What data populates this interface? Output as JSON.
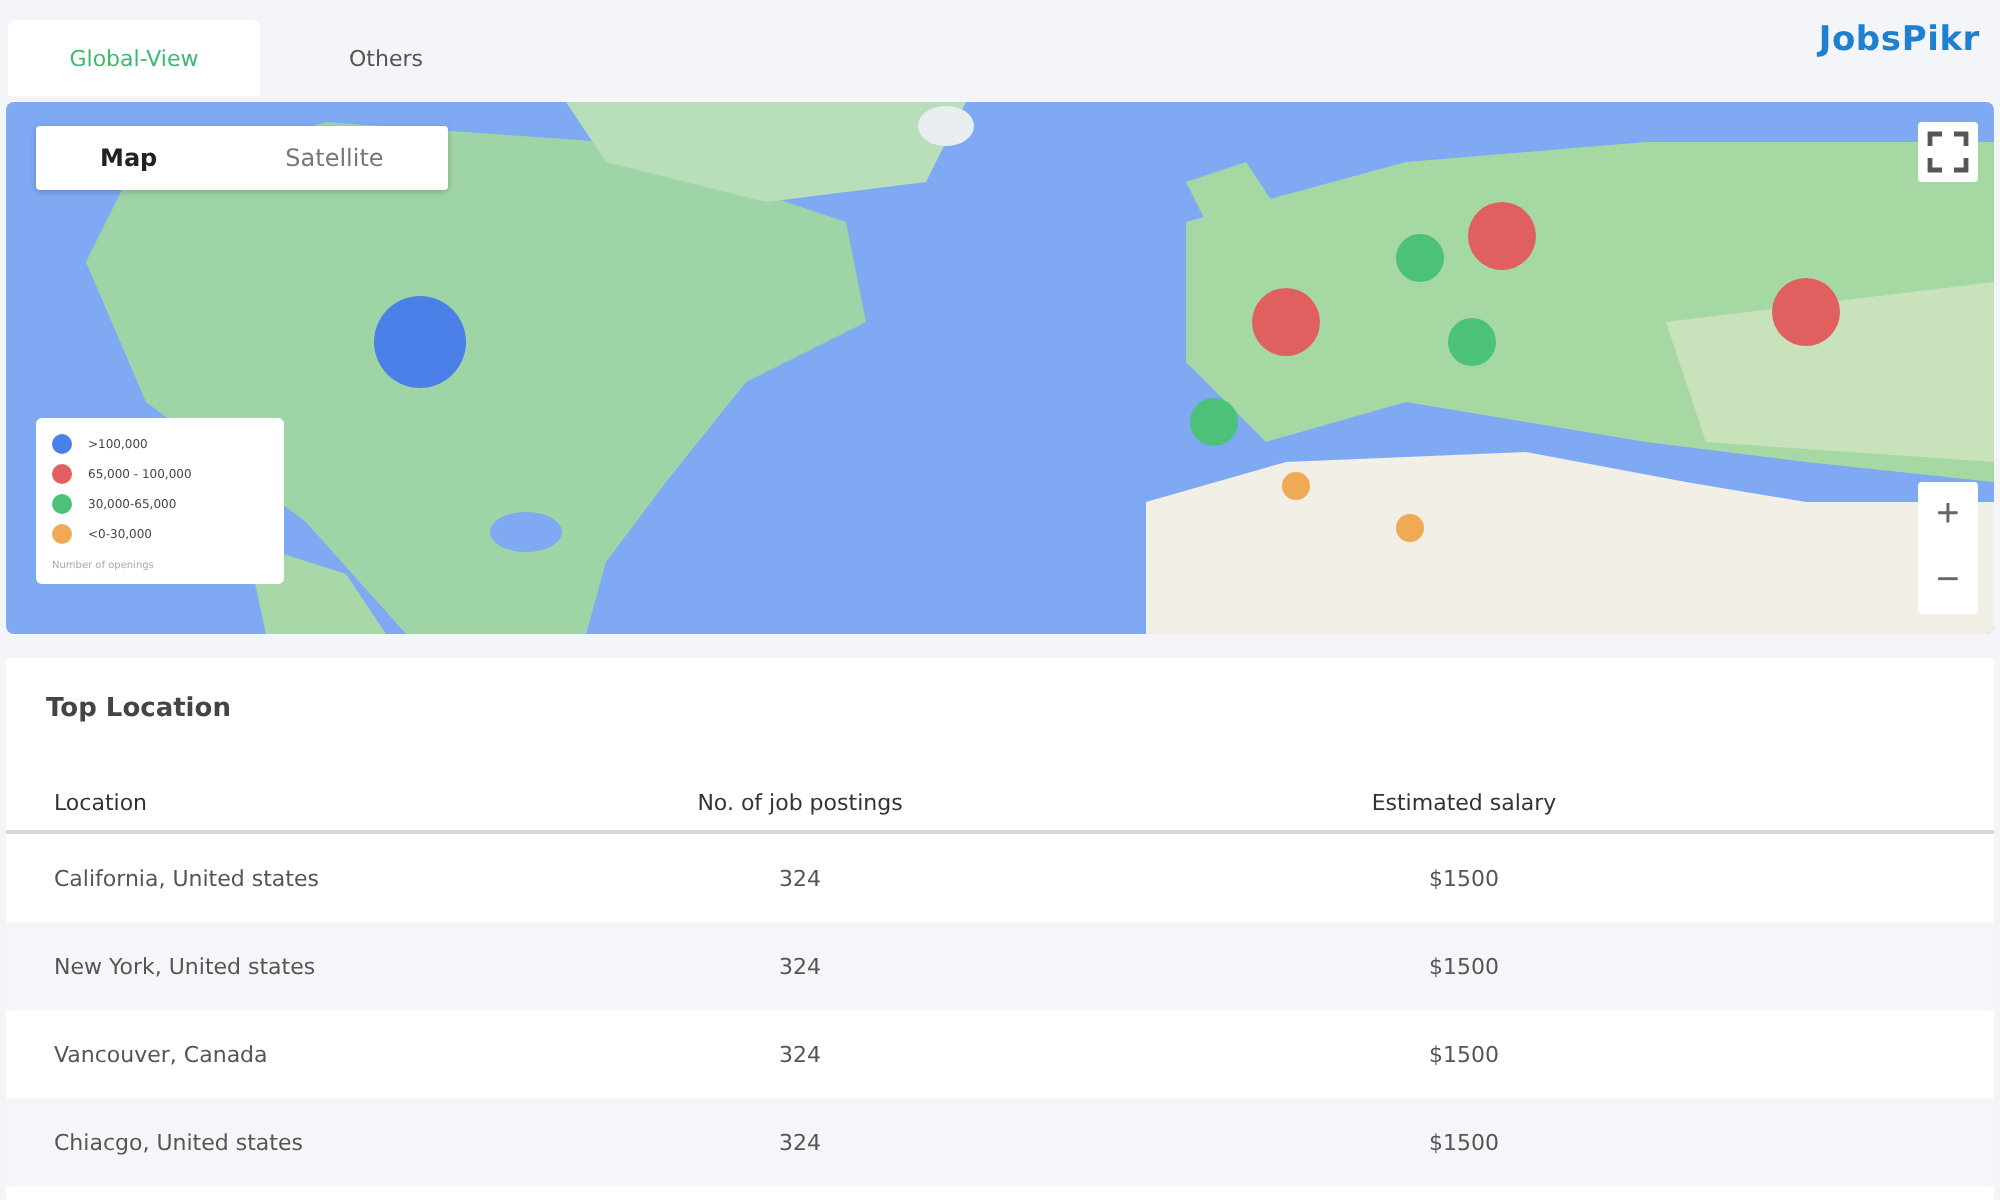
{
  "tabs": [
    {
      "label": "Global-View",
      "selected": true
    },
    {
      "label": "Others",
      "selected": false
    }
  ],
  "logo": "JobsPikr",
  "map": {
    "kind": "picture",
    "modes": [
      {
        "label": "Map",
        "selected": true
      },
      {
        "label": "Satellite",
        "selected": false
      }
    ],
    "zoom": [
      "+",
      "−"
    ],
    "legend": {
      "items": [
        {
          "label": ">100,000",
          "color": "#4a80e8"
        },
        {
          "label": "65,000 - 100,000",
          "color": "#e06060"
        },
        {
          "label": "30,000-65,000",
          "color": "#4cc17a"
        },
        {
          "label": "<0-30,000",
          "color": "#f0aa55"
        }
      ],
      "caption": "Number of openings"
    },
    "markers": [
      {
        "color": "#4a80e8"
      },
      {
        "color": "#e06060"
      },
      {
        "color": "#e06060"
      },
      {
        "color": "#e06060"
      },
      {
        "color": "#4cc17a"
      },
      {
        "color": "#4cc17a"
      },
      {
        "color": "#4cc17a"
      },
      {
        "color": "#f0aa55"
      },
      {
        "color": "#f0aa55"
      }
    ]
  },
  "table": {
    "title": "Top Location",
    "columns": [
      "Location",
      "No. of job postings",
      "Estimated salary"
    ],
    "rows": [
      [
        "California, United states",
        "324",
        "$1500"
      ],
      [
        "New York, United states",
        "324",
        "$1500"
      ],
      [
        "Vancouver, Canada",
        "324",
        "$1500"
      ],
      [
        "Chiacgo, United states",
        "324",
        "$1500"
      ]
    ]
  }
}
